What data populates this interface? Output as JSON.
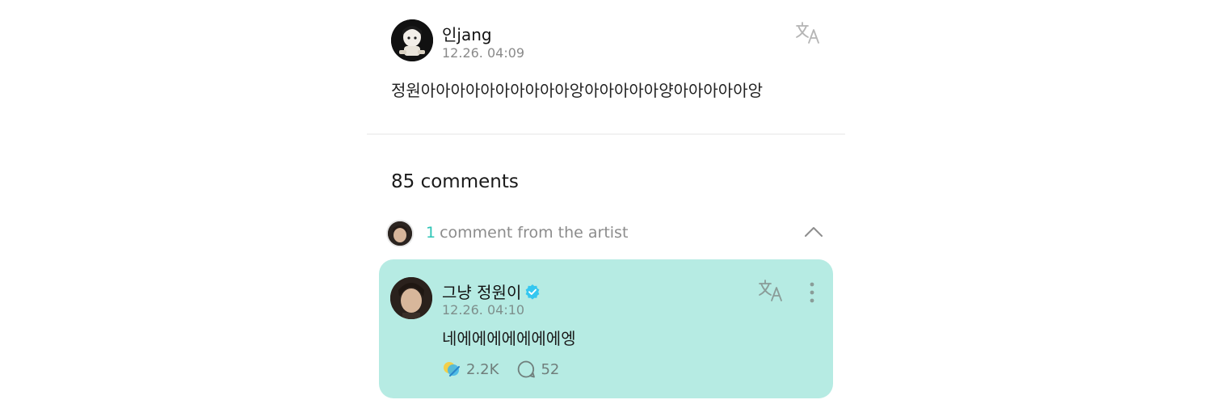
{
  "post": {
    "author": "인jang",
    "time": "12.26. 04:09",
    "body": "정원아아아아아아아아아아앙아아아아아양아아아아아앙",
    "translate_icon": "translate-icon",
    "avatar_icon": "avatar"
  },
  "comments": {
    "count_label": "85 comments"
  },
  "artist_section": {
    "count": "1",
    "label": "comment from the artist",
    "collapse_icon": "chevron-up-icon"
  },
  "artist_comment": {
    "name": "그냥 정원이",
    "verified_icon": "verified-badge-icon",
    "time": "12.26. 04:10",
    "text": "네에에에에에에에엥",
    "likes": "2.2K",
    "replies": "52",
    "like_icon": "reaction-icon",
    "reply_icon": "comment-bubble-icon",
    "more_icon": "more-vertical-icon"
  },
  "colors": {
    "accent": "#2ec5b6",
    "card_background": "#b6ebe3",
    "muted_text": "#8a8a8a"
  }
}
